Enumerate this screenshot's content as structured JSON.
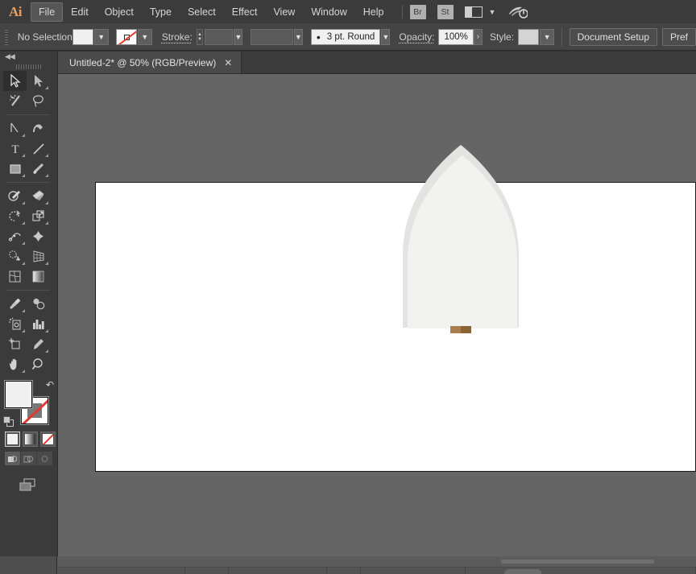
{
  "app": {
    "name": "Adobe Illustrator",
    "logo_text": "Ai",
    "accent": "#e89f64"
  },
  "menubar": {
    "items": [
      {
        "label": "File",
        "active": true
      },
      {
        "label": "Edit",
        "active": false
      },
      {
        "label": "Object",
        "active": false
      },
      {
        "label": "Type",
        "active": false
      },
      {
        "label": "Select",
        "active": false
      },
      {
        "label": "Effect",
        "active": false
      },
      {
        "label": "View",
        "active": false
      },
      {
        "label": "Window",
        "active": false
      },
      {
        "label": "Help",
        "active": false
      }
    ],
    "bridge_label": "Br",
    "stock_label": "St",
    "workspace_icon": "workspace-switcher-icon",
    "cc_icon": "creative-cloud-icon"
  },
  "controlbar": {
    "selection_status": "No Selection",
    "fill_swatch": "#f0f0f0",
    "stroke_swatch": "none",
    "stroke_label": "Stroke:",
    "stroke_weight": "",
    "stroke_profile": "",
    "brush_definition": "3 pt. Round",
    "opacity_label": "Opacity:",
    "opacity_value": "100%",
    "style_label": "Style:",
    "style_swatch": "#d4d4d4",
    "document_setup_label": "Document Setup",
    "preferences_label": "Pref"
  },
  "tabbar": {
    "tabs": [
      {
        "title": "Untitled-2* @ 50% (RGB/Preview)",
        "close_icon": "close-icon",
        "active": true
      }
    ]
  },
  "toolpanel": {
    "collapse_icon": "collapse-panel-icon",
    "tools": [
      {
        "name": "selection-tool",
        "selected": true,
        "has_flyout": false
      },
      {
        "name": "direct-selection-tool",
        "selected": false,
        "has_flyout": true
      },
      {
        "name": "magic-wand-tool",
        "selected": false,
        "has_flyout": false
      },
      {
        "name": "lasso-tool",
        "selected": false,
        "has_flyout": false
      },
      {
        "name": "pen-tool",
        "selected": false,
        "has_flyout": true
      },
      {
        "name": "curvature-tool",
        "selected": false,
        "has_flyout": false
      },
      {
        "name": "type-tool",
        "selected": false,
        "has_flyout": true
      },
      {
        "name": "line-segment-tool",
        "selected": false,
        "has_flyout": true
      },
      {
        "name": "rectangle-tool",
        "selected": false,
        "has_flyout": true
      },
      {
        "name": "paintbrush-tool",
        "selected": false,
        "has_flyout": true
      },
      {
        "name": "shaper-tool",
        "selected": false,
        "has_flyout": true
      },
      {
        "name": "eraser-tool",
        "selected": false,
        "has_flyout": true
      },
      {
        "name": "rotate-tool",
        "selected": false,
        "has_flyout": true
      },
      {
        "name": "scale-tool",
        "selected": false,
        "has_flyout": true
      },
      {
        "name": "width-tool",
        "selected": false,
        "has_flyout": true
      },
      {
        "name": "free-transform-tool",
        "selected": false,
        "has_flyout": false
      },
      {
        "name": "shape-builder-tool",
        "selected": false,
        "has_flyout": true
      },
      {
        "name": "perspective-grid-tool",
        "selected": false,
        "has_flyout": true
      },
      {
        "name": "mesh-tool",
        "selected": false,
        "has_flyout": false
      },
      {
        "name": "gradient-tool",
        "selected": false,
        "has_flyout": false
      },
      {
        "name": "eyedropper-tool",
        "selected": false,
        "has_flyout": true
      },
      {
        "name": "blend-tool",
        "selected": false,
        "has_flyout": false
      },
      {
        "name": "symbol-sprayer-tool",
        "selected": false,
        "has_flyout": true
      },
      {
        "name": "column-graph-tool",
        "selected": false,
        "has_flyout": true
      },
      {
        "name": "artboard-tool",
        "selected": false,
        "has_flyout": false
      },
      {
        "name": "slice-tool",
        "selected": false,
        "has_flyout": true
      },
      {
        "name": "hand-tool",
        "selected": false,
        "has_flyout": true
      },
      {
        "name": "zoom-tool",
        "selected": false,
        "has_flyout": false
      }
    ],
    "fill_color": "#f0f0f0",
    "stroke_color": "none",
    "swap_icon": "swap-fill-stroke-icon",
    "default_icon": "default-fill-stroke-icon",
    "fill_modes": [
      {
        "name": "color-fill-mode",
        "active": true
      },
      {
        "name": "gradient-fill-mode",
        "active": false
      },
      {
        "name": "none-fill-mode",
        "active": false
      }
    ],
    "draw_modes": [
      {
        "name": "draw-normal-mode",
        "active": true
      },
      {
        "name": "draw-behind-mode",
        "active": false
      },
      {
        "name": "draw-inside-mode",
        "active": false
      }
    ],
    "screen_mode": "change-screen-mode-icon"
  },
  "canvas": {
    "background": "#656565",
    "artboard_fill": "#ffffff",
    "zoom": "50%"
  },
  "artwork": {
    "name": "shovel-illustration",
    "blade_light": "#f0f0ee",
    "blade_shadow": "#e3e3e1",
    "handle_light": "#a97f4f",
    "handle_dark": "#8b6434"
  },
  "statusbar": {
    "scrollbar": "horizontal-scrollbar"
  }
}
